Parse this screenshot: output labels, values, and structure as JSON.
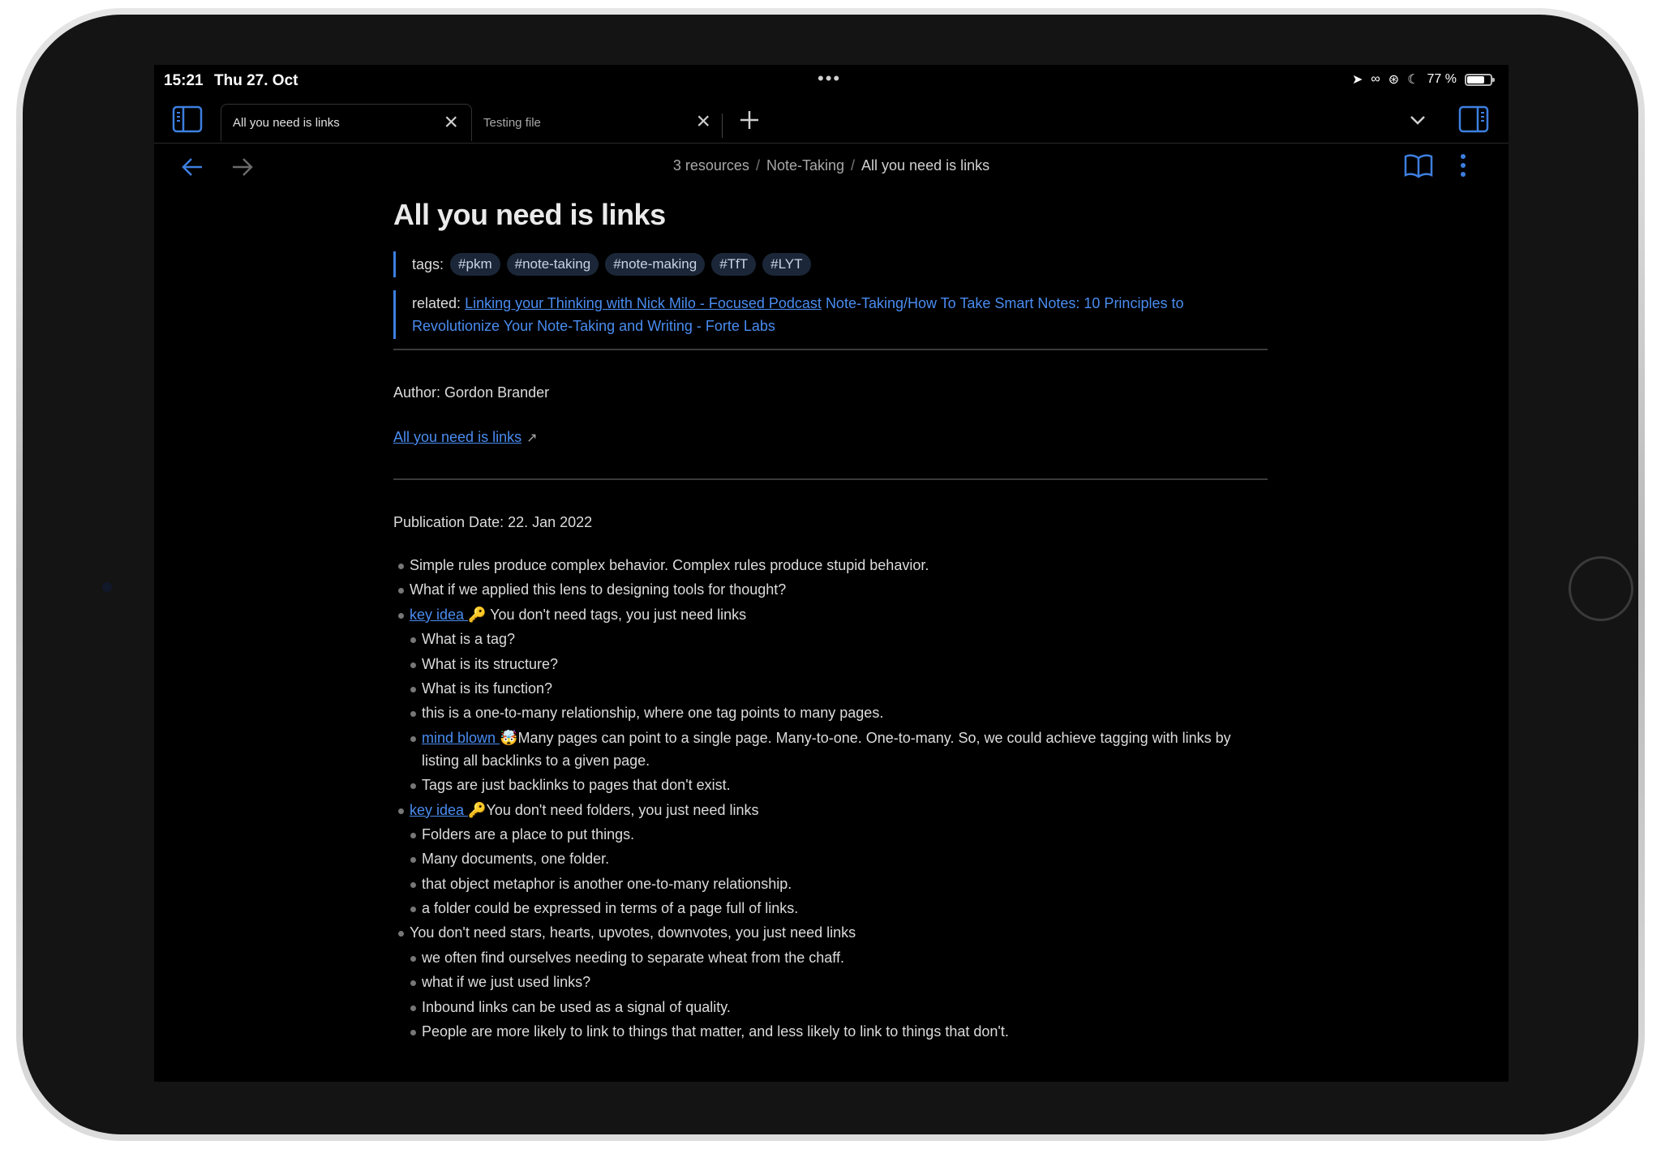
{
  "status": {
    "time": "15:21",
    "date": "Thu 27. Oct",
    "battery_text": "77 %",
    "battery_level": 0.77
  },
  "tabs": [
    {
      "label": "All you need is links",
      "active": true
    },
    {
      "label": "Testing file",
      "active": false
    }
  ],
  "breadcrumb": [
    "3 resources",
    "Note-Taking",
    "All you need is links"
  ],
  "note": {
    "title": "All you need is links",
    "tags_label": "tags:",
    "tags": [
      "#pkm",
      "#note-taking",
      "#note-making",
      "#TfT",
      "#LYT"
    ],
    "related_label": "related:",
    "related_link_1": "Linking your Thinking with Nick Milo - Focused Podcast",
    "related_link_2": "Note-Taking/How To Take Smart Notes: 10 Principles to Revolutionize Your Note-Taking and Writing - Forte Labs",
    "author": "Author: Gordon Brander",
    "external_link": "All you need is links",
    "publication_date": "Publication Date: 22. Jan 2022",
    "bullets": [
      {
        "level": 1,
        "text": "Simple rules produce complex behavior. Complex rules produce stupid behavior."
      },
      {
        "level": 1,
        "text": "What if we applied this lens to designing tools for thought?"
      },
      {
        "level": 1,
        "link": "key idea",
        "emoji": "🔑",
        "text": " You don't need tags, you just need links"
      },
      {
        "level": 2,
        "text": "What is a tag?"
      },
      {
        "level": 2,
        "text": "What is its structure?"
      },
      {
        "level": 2,
        "text": "What is its function?"
      },
      {
        "level": 2,
        "text": "this is a one-to-many relationship, where one tag points to many pages."
      },
      {
        "level": 2,
        "link": "mind blown",
        "emoji": "🤯",
        "text": "Many pages can point to a single page. Many-to-one. One-to-many. So, we could achieve tagging with links by listing all backlinks to a given page."
      },
      {
        "level": 2,
        "text": "Tags are just backlinks to pages that don't exist."
      },
      {
        "level": 1,
        "link": "key idea",
        "emoji": "🔑",
        "text": "You don't need folders, you just need links"
      },
      {
        "level": 2,
        "text": "Folders are a place to put things."
      },
      {
        "level": 2,
        "text": "Many documents, one folder."
      },
      {
        "level": 2,
        "text": "that object metaphor is another one-to-many relationship."
      },
      {
        "level": 2,
        "text": "a folder could be expressed in terms of a page full of links."
      },
      {
        "level": 1,
        "text": "You don't need stars, hearts, upvotes, downvotes, you just need links"
      },
      {
        "level": 2,
        "text": "we often find ourselves needing to separate wheat from the chaff."
      },
      {
        "level": 2,
        "text": "what if we just used links?"
      },
      {
        "level": 2,
        "text": "Inbound links can be used as a signal of quality."
      },
      {
        "level": 2,
        "text": "People are more likely to link to things that matter, and less likely to link to things that don't."
      }
    ]
  },
  "colors": {
    "accent": "#3d7fe0",
    "link": "#4a8cf0",
    "background": "#000000",
    "tag_bg": "#1b2738"
  },
  "icons": [
    "left-sidebar-icon",
    "close-icon",
    "plus-icon",
    "chevron-down-icon",
    "right-sidebar-icon",
    "back-arrow-icon",
    "forward-arrow-icon",
    "reading-view-icon",
    "more-options-icon",
    "external-link-icon"
  ]
}
